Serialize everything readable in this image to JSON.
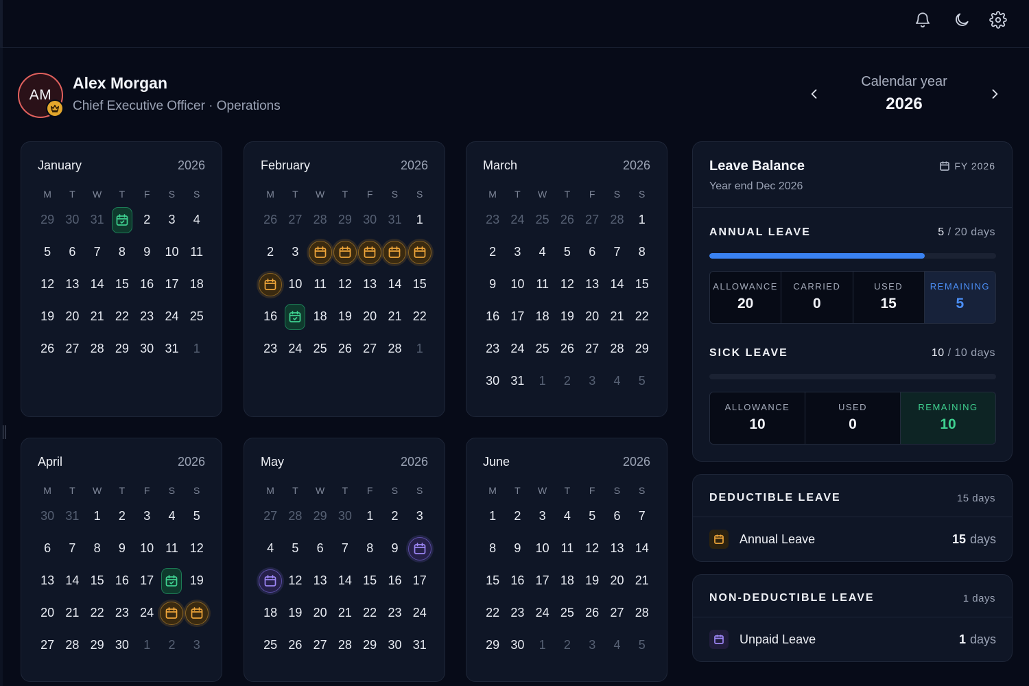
{
  "topbar": {
    "icons": [
      "bell-icon",
      "moon-icon",
      "gear-icon"
    ]
  },
  "profile": {
    "initials": "AM",
    "name": "Alex Morgan",
    "role": "Chief Executive Officer · Operations",
    "badge_icon": "crown-icon"
  },
  "year_nav": {
    "label": "Calendar year",
    "year": "2026"
  },
  "weekdays": [
    "M",
    "T",
    "W",
    "T",
    "F",
    "S",
    "S"
  ],
  "months": [
    {
      "name": "January",
      "year": "2026",
      "weeks": [
        [
          "29",
          "30",
          "31",
          "1",
          "2",
          "3",
          "4"
        ],
        [
          "5",
          "6",
          "7",
          "8",
          "9",
          "10",
          "11"
        ],
        [
          "12",
          "13",
          "14",
          "15",
          "16",
          "17",
          "18"
        ],
        [
          "19",
          "20",
          "21",
          "22",
          "23",
          "24",
          "25"
        ],
        [
          "26",
          "27",
          "28",
          "29",
          "30",
          "31",
          "1"
        ]
      ],
      "leading_out": 3,
      "trailing_out": 1,
      "marks": {
        "0-3": "green"
      }
    },
    {
      "name": "February",
      "year": "2026",
      "weeks": [
        [
          "26",
          "27",
          "28",
          "29",
          "30",
          "31",
          "1"
        ],
        [
          "2",
          "3",
          "4",
          "5",
          "6",
          "7",
          "8"
        ],
        [
          "9",
          "10",
          "11",
          "12",
          "13",
          "14",
          "15"
        ],
        [
          "16",
          "17",
          "18",
          "19",
          "20",
          "21",
          "22"
        ],
        [
          "23",
          "24",
          "25",
          "26",
          "27",
          "28",
          "1"
        ]
      ],
      "leading_out": 6,
      "trailing_out": 1,
      "marks": {
        "1-2": "orange",
        "1-3": "orange",
        "1-4": "orange",
        "1-5": "orange",
        "1-6": "orange",
        "2-0": "orange",
        "3-1": "green"
      }
    },
    {
      "name": "March",
      "year": "2026",
      "weeks": [
        [
          "23",
          "24",
          "25",
          "26",
          "27",
          "28",
          "1"
        ],
        [
          "2",
          "3",
          "4",
          "5",
          "6",
          "7",
          "8"
        ],
        [
          "9",
          "10",
          "11",
          "12",
          "13",
          "14",
          "15"
        ],
        [
          "16",
          "17",
          "18",
          "19",
          "20",
          "21",
          "22"
        ],
        [
          "23",
          "24",
          "25",
          "26",
          "27",
          "28",
          "29"
        ],
        [
          "30",
          "31",
          "1",
          "2",
          "3",
          "4",
          "5"
        ]
      ],
      "leading_out": 6,
      "trailing_out": 5,
      "marks": {}
    },
    {
      "name": "April",
      "year": "2026",
      "weeks": [
        [
          "30",
          "31",
          "1",
          "2",
          "3",
          "4",
          "5"
        ],
        [
          "6",
          "7",
          "8",
          "9",
          "10",
          "11",
          "12"
        ],
        [
          "13",
          "14",
          "15",
          "16",
          "17",
          "18",
          "19"
        ],
        [
          "20",
          "21",
          "22",
          "23",
          "24",
          "25",
          "26"
        ],
        [
          "27",
          "28",
          "29",
          "30",
          "1",
          "2",
          "3"
        ]
      ],
      "leading_out": 2,
      "trailing_out": 3,
      "marks": {
        "2-5": "green",
        "3-5": "orange",
        "3-6": "orange"
      }
    },
    {
      "name": "May",
      "year": "2026",
      "weeks": [
        [
          "27",
          "28",
          "29",
          "30",
          "1",
          "2",
          "3"
        ],
        [
          "4",
          "5",
          "6",
          "7",
          "8",
          "9",
          "10"
        ],
        [
          "11",
          "12",
          "13",
          "14",
          "15",
          "16",
          "17"
        ],
        [
          "18",
          "19",
          "20",
          "21",
          "22",
          "23",
          "24"
        ],
        [
          "25",
          "26",
          "27",
          "28",
          "29",
          "30",
          "31"
        ]
      ],
      "leading_out": 4,
      "trailing_out": 0,
      "marks": {
        "1-6": "purple",
        "2-0": "purple"
      }
    },
    {
      "name": "June",
      "year": "2026",
      "weeks": [
        [
          "1",
          "2",
          "3",
          "4",
          "5",
          "6",
          "7"
        ],
        [
          "8",
          "9",
          "10",
          "11",
          "12",
          "13",
          "14"
        ],
        [
          "15",
          "16",
          "17",
          "18",
          "19",
          "20",
          "21"
        ],
        [
          "22",
          "23",
          "24",
          "25",
          "26",
          "27",
          "28"
        ],
        [
          "29",
          "30",
          "1",
          "2",
          "3",
          "4",
          "5"
        ]
      ],
      "leading_out": 0,
      "trailing_out": 5,
      "marks": {}
    }
  ],
  "leave_balance": {
    "title": "Leave Balance",
    "subtitle": "Year end Dec 2026",
    "fy": "FY 2026",
    "annual": {
      "label": "ANNUAL LEAVE",
      "used": "5",
      "total": "/ 20 days",
      "progress": 0.75,
      "stats": [
        {
          "label": "ALLOWANCE",
          "value": "20"
        },
        {
          "label": "CARRIED",
          "value": "0"
        },
        {
          "label": "USED",
          "value": "15"
        },
        {
          "label": "REMAINING",
          "value": "5"
        }
      ]
    },
    "sick": {
      "label": "SICK LEAVE",
      "used": "10",
      "total": "/ 10 days",
      "progress": 0,
      "stats": [
        {
          "label": "ALLOWANCE",
          "value": "10"
        },
        {
          "label": "USED",
          "value": "0"
        },
        {
          "label": "REMAINING",
          "value": "10"
        }
      ]
    }
  },
  "deductible": {
    "label": "DEDUCTIBLE LEAVE",
    "total": "15 days",
    "items": [
      {
        "label": "Annual Leave",
        "value": "15",
        "unit": "days",
        "icon": "calendar-icon",
        "color": "#f0a63a"
      }
    ]
  },
  "non_deductible": {
    "label": "NON-DEDUCTIBLE LEAVE",
    "total": "1 days",
    "items": [
      {
        "label": "Unpaid Leave",
        "value": "1",
        "unit": "days",
        "icon": "calendar-icon",
        "color": "#9d86f5"
      }
    ]
  }
}
